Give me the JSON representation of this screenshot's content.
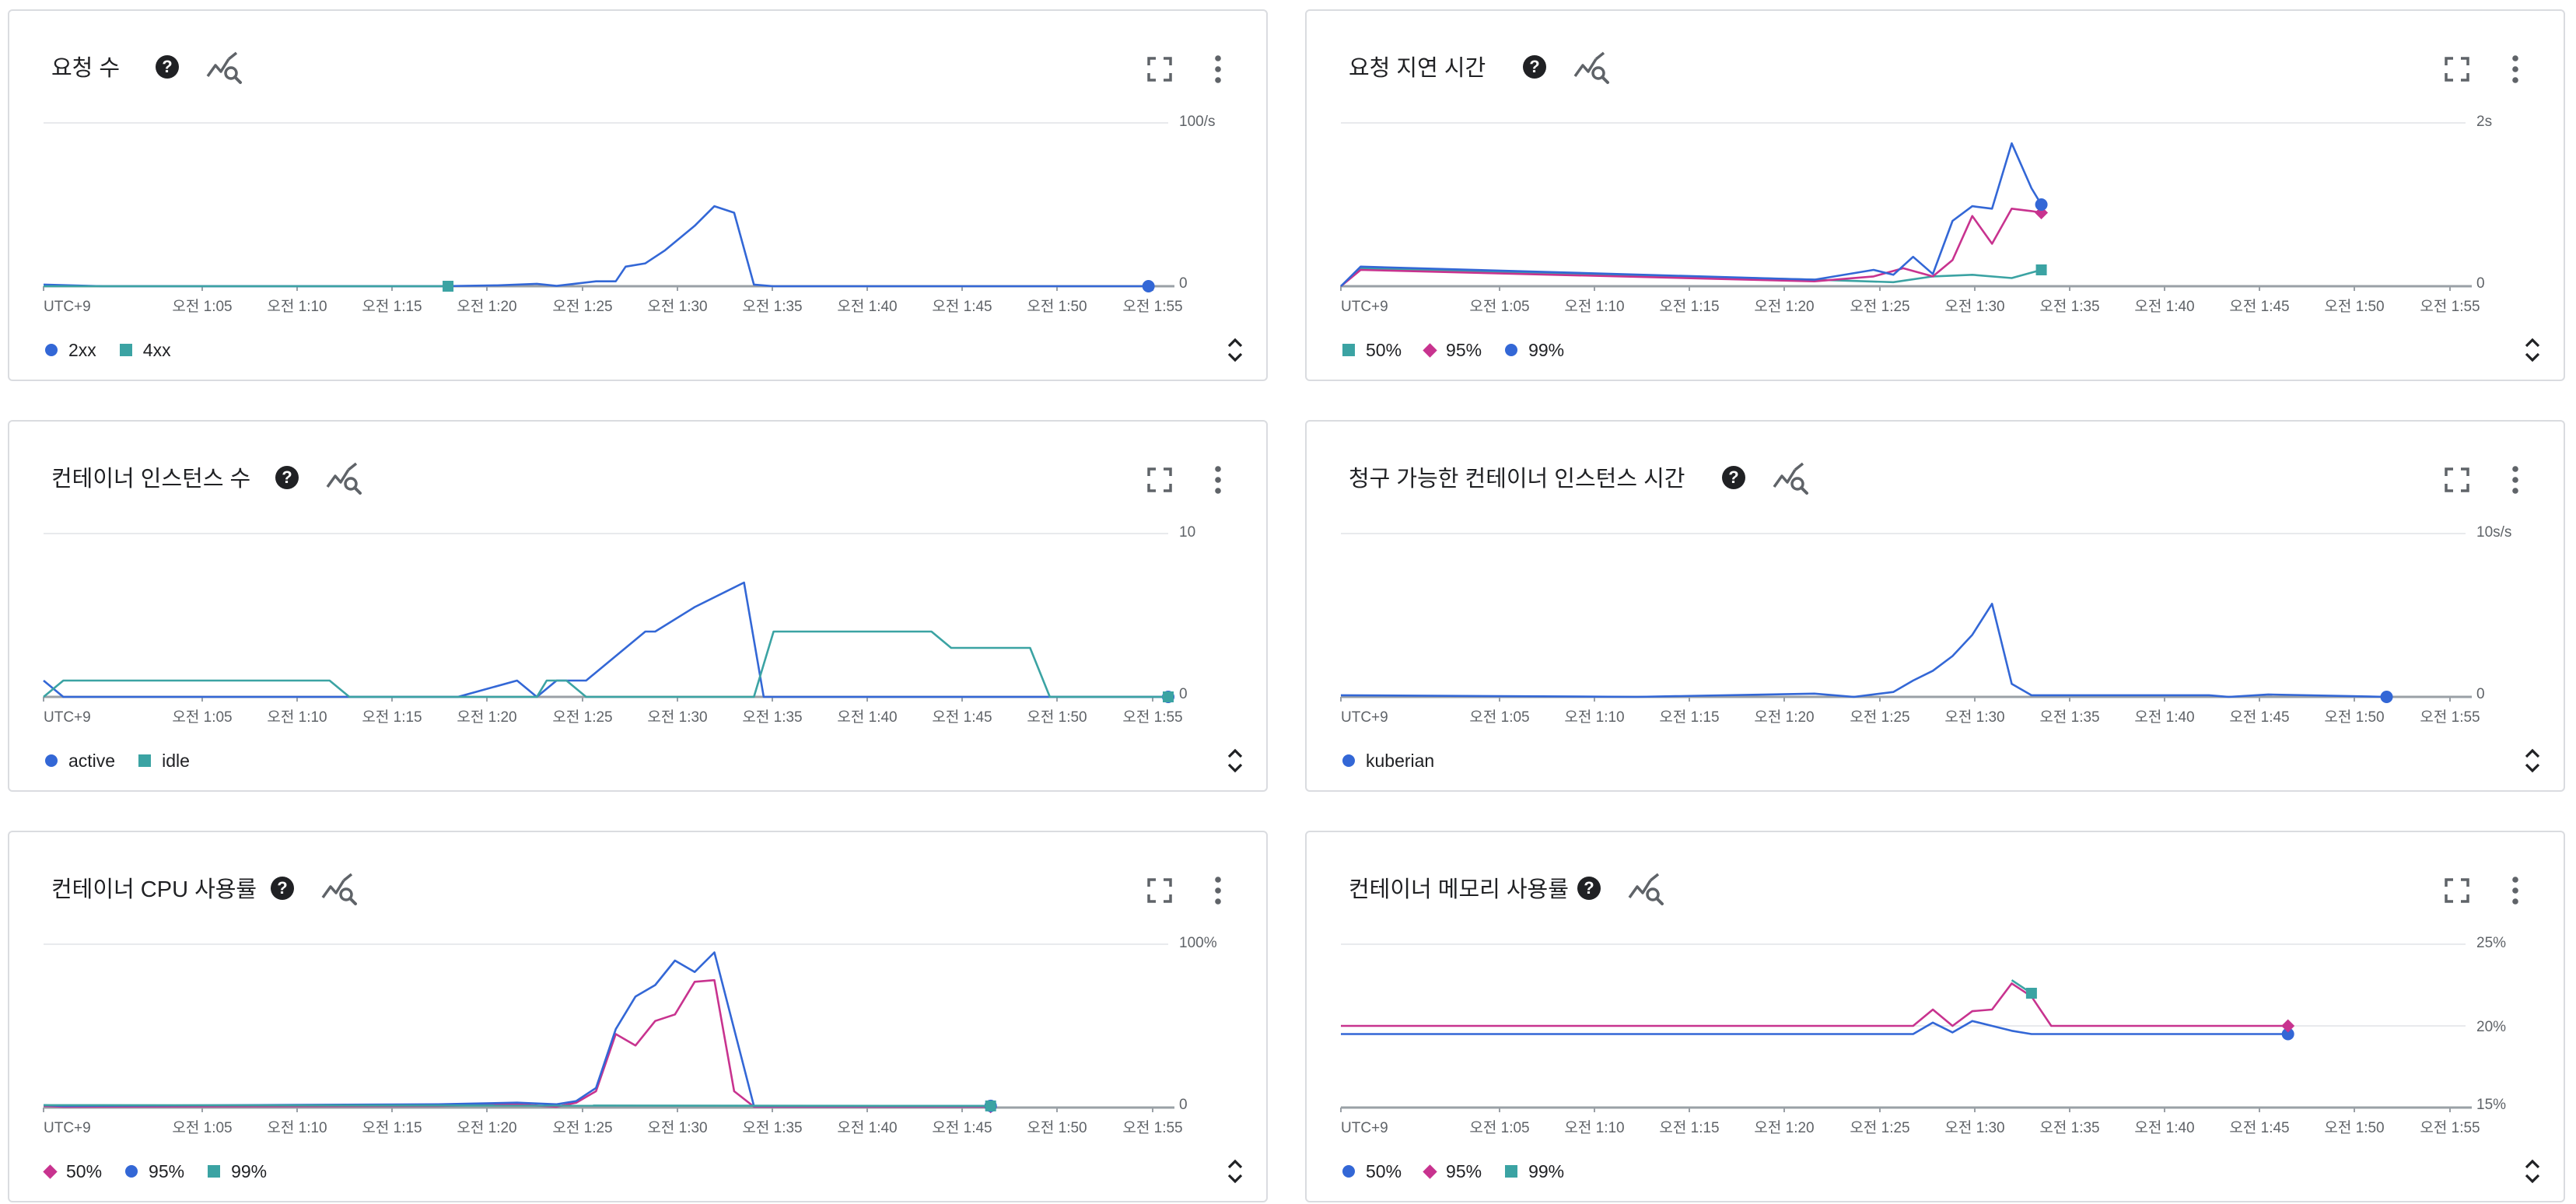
{
  "colors": {
    "2xx": "#3367d6",
    "4xx": "#3ba3a3",
    "p95": "#c8338f",
    "grid": "#e8eaed",
    "axis": "#5f6368"
  },
  "icons": [
    "help-icon",
    "explore-icon",
    "fullscreen-icon",
    "more-vert-icon",
    "expand-icon"
  ],
  "x_axis": {
    "ticks": [
      "UTC+9",
      "오전 1:05",
      "오전 1:10",
      "오전 1:15",
      "오전 1:20",
      "오전 1:25",
      "오전 1:30",
      "오전 1:35",
      "오전 1:40",
      "오전 1:45",
      "오전 1:50",
      "오전 1:55"
    ]
  },
  "cards": [
    {
      "title": "요청 수",
      "ytop": "100/s",
      "ybottom": "0",
      "legend": [
        {
          "label": "2xx",
          "shape": "circle",
          "color": "#3367d6"
        },
        {
          "label": "4xx",
          "shape": "square",
          "color": "#3ba3a3"
        }
      ],
      "chart_data": {
        "type": "line",
        "title": "요청 수",
        "x": "minutes after 오전 1:00",
        "ylim": [
          0,
          100
        ],
        "series": [
          {
            "name": "2xx",
            "color": "#3367d6",
            "marker": "circle",
            "points": [
              [
                0,
                1
              ],
              [
                3,
                0
              ],
              [
                20,
                0
              ],
              [
                23,
                0.5
              ],
              [
                25,
                1.5
              ],
              [
                26,
                0.2
              ],
              [
                28,
                3
              ],
              [
                29,
                3
              ],
              [
                29.5,
                12
              ],
              [
                30.5,
                14
              ],
              [
                31.5,
                22
              ],
              [
                33,
                37
              ],
              [
                34,
                49
              ],
              [
                35,
                45
              ],
              [
                36,
                1
              ],
              [
                37,
                0
              ],
              [
                56,
                0
              ]
            ]
          },
          {
            "name": "4xx",
            "color": "#3ba3a3",
            "marker": "square",
            "points": [
              [
                0,
                0
              ],
              [
                20.5,
                0
              ]
            ]
          }
        ]
      }
    },
    {
      "title": "요청 지연 시간",
      "ytop": "2s",
      "ybottom": "0",
      "legend": [
        {
          "label": "50%",
          "shape": "square",
          "color": "#3ba3a3"
        },
        {
          "label": "95%",
          "shape": "diamond",
          "color": "#c8338f"
        },
        {
          "label": "99%",
          "shape": "circle",
          "color": "#3367d6"
        }
      ],
      "chart_data": {
        "type": "line",
        "title": "요청 지연 시간",
        "x": "minutes after 오전 1:00",
        "ylim": [
          0,
          2
        ],
        "series": [
          {
            "name": "50%",
            "color": "#3ba3a3",
            "marker": "square",
            "points": [
              [
                0,
                0
              ],
              [
                1,
                0.22
              ],
              [
                24,
                0.08
              ],
              [
                28,
                0.05
              ],
              [
                30,
                0.12
              ],
              [
                32,
                0.14
              ],
              [
                34,
                0.1
              ],
              [
                35.5,
                0.2
              ]
            ]
          },
          {
            "name": "95%",
            "color": "#c8338f",
            "marker": "diamond",
            "points": [
              [
                0,
                0
              ],
              [
                1,
                0.2
              ],
              [
                24,
                0.06
              ],
              [
                27,
                0.12
              ],
              [
                28.5,
                0.22
              ],
              [
                30,
                0.12
              ],
              [
                31,
                0.32
              ],
              [
                32,
                0.86
              ],
              [
                33,
                0.52
              ],
              [
                34,
                0.95
              ],
              [
                35,
                0.92
              ],
              [
                35.5,
                0.9
              ]
            ]
          },
          {
            "name": "99%",
            "color": "#3367d6",
            "marker": "circle",
            "points": [
              [
                0,
                0
              ],
              [
                1,
                0.24
              ],
              [
                24,
                0.08
              ],
              [
                27,
                0.2
              ],
              [
                28,
                0.14
              ],
              [
                29,
                0.36
              ],
              [
                30,
                0.15
              ],
              [
                31,
                0.8
              ],
              [
                32,
                0.98
              ],
              [
                33,
                0.95
              ],
              [
                34,
                1.75
              ],
              [
                35,
                1.2
              ],
              [
                35.5,
                1.0
              ]
            ]
          }
        ]
      }
    },
    {
      "title": "컨테이너 인스턴스 수",
      "ytop": "10",
      "ybottom": "0",
      "legend": [
        {
          "label": "active",
          "shape": "circle",
          "color": "#3367d6"
        },
        {
          "label": "idle",
          "shape": "square",
          "color": "#3ba3a3"
        }
      ],
      "chart_data": {
        "type": "line",
        "title": "컨테이너 인스턴스 수",
        "x": "minutes after 오전 1:00",
        "ylim": [
          0,
          10
        ],
        "series": [
          {
            "name": "active",
            "color": "#3367d6",
            "marker": "circle",
            "points": [
              [
                0,
                1
              ],
              [
                1,
                0
              ],
              [
                21,
                0
              ],
              [
                24,
                1
              ],
              [
                25,
                0
              ],
              [
                26,
                1
              ],
              [
                27.5,
                1
              ],
              [
                30.5,
                4
              ],
              [
                31,
                4
              ],
              [
                33,
                5.5
              ],
              [
                35.5,
                7
              ],
              [
                36.5,
                0
              ],
              [
                57,
                0
              ]
            ]
          },
          {
            "name": "idle",
            "color": "#3ba3a3",
            "marker": "square",
            "points": [
              [
                0,
                0
              ],
              [
                1,
                1
              ],
              [
                14.5,
                1
              ],
              [
                15.5,
                0
              ],
              [
                25,
                0
              ],
              [
                25.5,
                1
              ],
              [
                26.5,
                1
              ],
              [
                27.5,
                0
              ],
              [
                36,
                0
              ],
              [
                37,
                4
              ],
              [
                45,
                4
              ],
              [
                46,
                3
              ],
              [
                50,
                3
              ],
              [
                51,
                0
              ],
              [
                57,
                0
              ]
            ]
          }
        ]
      }
    },
    {
      "title": "청구 가능한 컨테이너 인스턴스 시간",
      "ytop": "10s/s",
      "ybottom": "0",
      "legend": [
        {
          "label": "kuberian",
          "shape": "circle",
          "color": "#3367d6"
        }
      ],
      "chart_data": {
        "type": "line",
        "title": "청구 가능한 컨테이너 인스턴스 시간",
        "x": "minutes after 오전 1:00",
        "ylim": [
          0,
          10
        ],
        "series": [
          {
            "name": "kuberian",
            "color": "#3367d6",
            "marker": "circle",
            "points": [
              [
                0,
                0.1
              ],
              [
                15,
                0
              ],
              [
                24,
                0.2
              ],
              [
                26,
                0
              ],
              [
                28,
                0.3
              ],
              [
                29,
                1
              ],
              [
                30,
                1.6
              ],
              [
                31,
                2.5
              ],
              [
                32,
                3.8
              ],
              [
                33,
                5.7
              ],
              [
                34,
                0.8
              ],
              [
                35,
                0.1
              ],
              [
                44,
                0.1
              ],
              [
                45,
                0
              ],
              [
                47,
                0.15
              ],
              [
                53,
                0
              ]
            ]
          }
        ]
      }
    },
    {
      "title": "컨테이너 CPU 사용률",
      "ytop": "100%",
      "ybottom": "0",
      "legend": [
        {
          "label": "50%",
          "shape": "diamond",
          "color": "#c8338f"
        },
        {
          "label": "95%",
          "shape": "circle",
          "color": "#3367d6"
        },
        {
          "label": "99%",
          "shape": "square",
          "color": "#3ba3a3"
        }
      ],
      "chart_data": {
        "type": "line",
        "title": "컨테이너 CPU 사용률",
        "x": "minutes after 오전 1:00",
        "ylim": [
          0,
          100
        ],
        "series": [
          {
            "name": "50%",
            "color": "#c8338f",
            "marker": "diamond",
            "points": [
              [
                0,
                1
              ],
              [
                1,
                0.5
              ],
              [
                20,
                1
              ],
              [
                24,
                2
              ],
              [
                26,
                0.5
              ],
              [
                27,
                3
              ],
              [
                28,
                10
              ],
              [
                29,
                45
              ],
              [
                30,
                38
              ],
              [
                31,
                53
              ],
              [
                32,
                57
              ],
              [
                33,
                77
              ],
              [
                34,
                78
              ],
              [
                35,
                10
              ],
              [
                36,
                0.5
              ],
              [
                48,
                0.5
              ]
            ]
          },
          {
            "name": "95%",
            "color": "#3367d6",
            "marker": "circle",
            "points": [
              [
                0,
                1.5
              ],
              [
                1,
                1
              ],
              [
                20,
                2
              ],
              [
                24,
                3
              ],
              [
                26,
                2
              ],
              [
                27,
                4
              ],
              [
                28,
                12
              ],
              [
                29,
                48
              ],
              [
                30,
                68
              ],
              [
                31,
                75
              ],
              [
                32,
                90
              ],
              [
                33,
                83
              ],
              [
                34,
                95
              ],
              [
                36,
                1
              ],
              [
                48,
                1
              ]
            ]
          },
          {
            "name": "99%",
            "color": "#3ba3a3",
            "marker": "square",
            "points": [
              [
                0,
                1.5
              ],
              [
                48,
                1
              ]
            ]
          }
        ]
      }
    },
    {
      "title": "컨테이너 메모리 사용률",
      "ytop": "25%",
      "ybottom": "15%",
      "ymid": "20%",
      "legend": [
        {
          "label": "50%",
          "shape": "circle",
          "color": "#3367d6"
        },
        {
          "label": "95%",
          "shape": "diamond",
          "color": "#c8338f"
        },
        {
          "label": "99%",
          "shape": "square",
          "color": "#3ba3a3"
        }
      ],
      "chart_data": {
        "type": "line",
        "title": "컨테이너 메모리 사용률",
        "x": "minutes after 오전 1:00",
        "ylim": [
          15,
          25
        ],
        "series": [
          {
            "name": "50%",
            "color": "#3367d6",
            "marker": "circle",
            "points": [
              [
                0,
                19.5
              ],
              [
                29,
                19.5
              ],
              [
                30,
                20.2
              ],
              [
                31,
                19.6
              ],
              [
                32,
                20.3
              ],
              [
                33,
                20
              ],
              [
                34,
                19.7
              ],
              [
                35,
                19.5
              ],
              [
                48,
                19.5
              ]
            ]
          },
          {
            "name": "95%",
            "color": "#c8338f",
            "marker": "diamond",
            "points": [
              [
                0,
                20
              ],
              [
                29,
                20
              ],
              [
                30,
                21
              ],
              [
                31,
                20
              ],
              [
                32,
                20.9
              ],
              [
                33,
                21
              ],
              [
                34,
                22.6
              ],
              [
                35,
                21.8
              ],
              [
                36,
                20
              ],
              [
                48,
                20
              ]
            ]
          },
          {
            "name": "99%",
            "color": "#3ba3a3",
            "marker": "square",
            "points": [
              [
                34,
                22.8
              ],
              [
                35,
                22
              ]
            ]
          }
        ]
      }
    }
  ]
}
